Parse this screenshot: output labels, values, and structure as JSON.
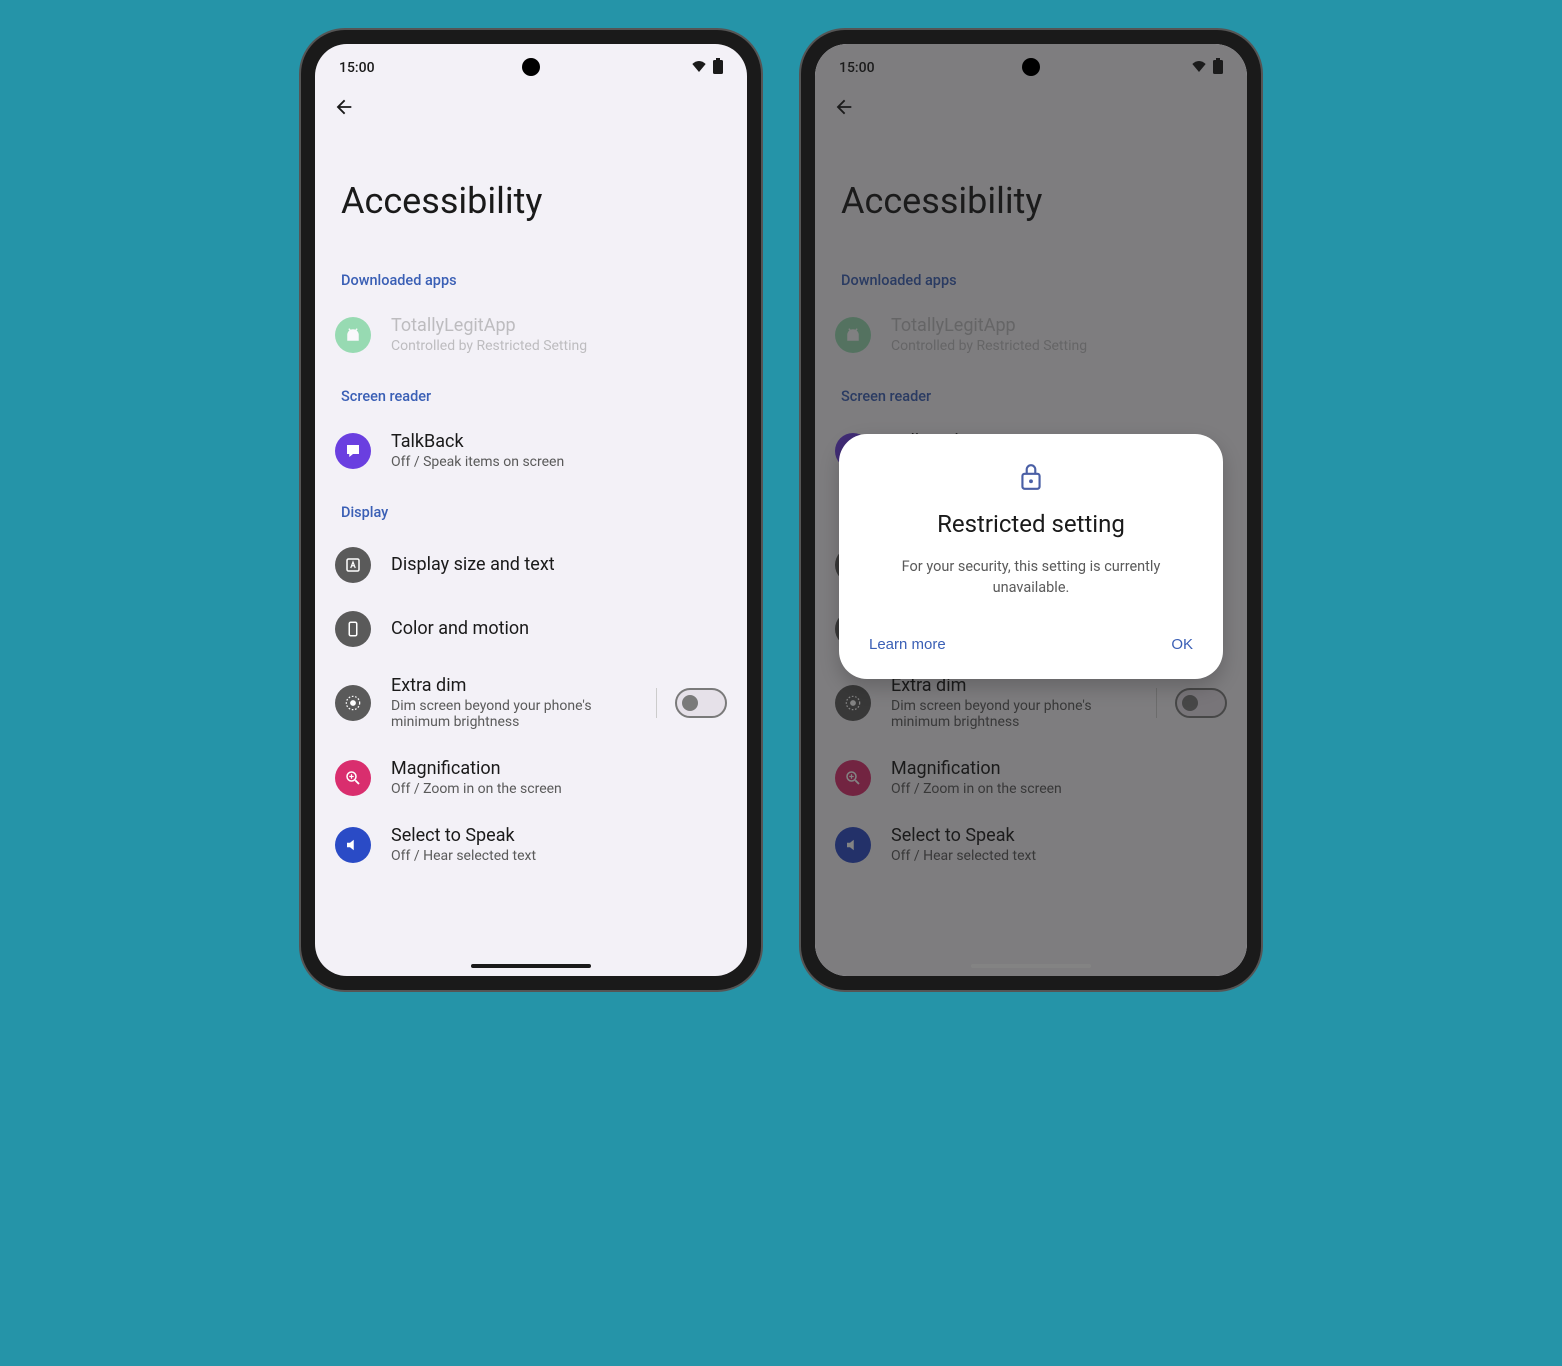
{
  "status": {
    "time": "15:00"
  },
  "page": {
    "title": "Accessibility"
  },
  "sections": {
    "downloaded": {
      "header": "Downloaded apps",
      "item0": {
        "title": "TotallyLegitApp",
        "sub": "Controlled by Restricted Setting"
      }
    },
    "screen_reader": {
      "header": "Screen reader",
      "item0": {
        "title": "TalkBack",
        "sub": "Off / Speak items on screen"
      }
    },
    "display": {
      "header": "Display",
      "item0": {
        "title": "Display size and text"
      },
      "item1": {
        "title": "Color and motion"
      },
      "item2": {
        "title": "Extra dim",
        "sub": "Dim screen beyond your phone's minimum brightness"
      },
      "item3": {
        "title": "Magnification",
        "sub": "Off / Zoom in on the screen"
      },
      "item4": {
        "title": "Select to Speak",
        "sub": "Off / Hear selected text"
      }
    }
  },
  "dialog": {
    "title": "Restricted setting",
    "body": "For your security, this setting is currently unavailable.",
    "learn": "Learn more",
    "ok": "OK"
  }
}
